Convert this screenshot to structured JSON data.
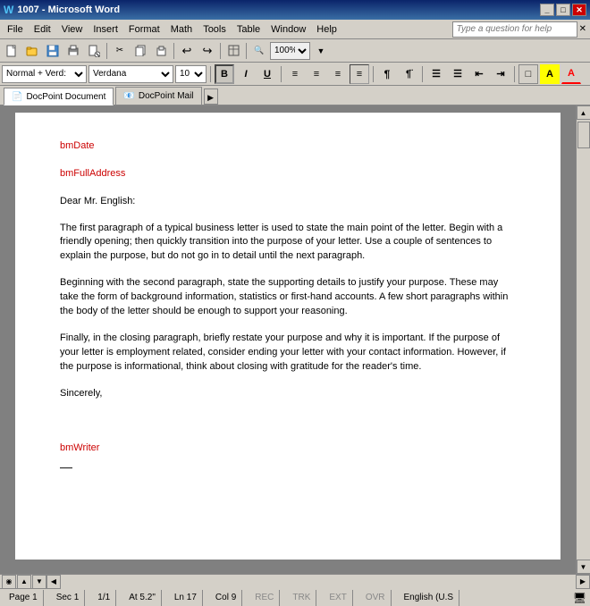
{
  "title_bar": {
    "title": "1007 - Microsoft Word",
    "icon": "W",
    "controls": [
      "_",
      "□",
      "✕"
    ]
  },
  "menu_bar": {
    "items": [
      "File",
      "Edit",
      "View",
      "Insert",
      "Format",
      "Math",
      "Tools",
      "Table",
      "Window",
      "Help"
    ],
    "search_placeholder": "Type a question for help"
  },
  "toolbar": {
    "buttons": [
      "📄",
      "📁",
      "💾",
      "🖨",
      "👁",
      "✂",
      "📋",
      "📎",
      "↩",
      "↪",
      "📊",
      "🔍"
    ],
    "zoom": "100%"
  },
  "format_toolbar": {
    "style": "Normal + Verd:",
    "font": "Verdana",
    "size": "10",
    "bold": true,
    "italic": false,
    "underline": false
  },
  "tabs": [
    {
      "label": "DocPoint Document",
      "active": true,
      "icon": "doc"
    },
    {
      "label": "DocPoint Mail",
      "active": false,
      "icon": "mail"
    }
  ],
  "document": {
    "bookmark1": "bmDate",
    "bookmark2": "bmFullAddress",
    "salutation": "Dear Mr. English:",
    "paragraph1": "The first paragraph of a typical business letter is used to state the main point of the letter. Begin with a friendly opening; then quickly transition into the purpose of your letter. Use a couple of sentences to explain the purpose, but do not go in to detail until the next paragraph.",
    "paragraph2": "Beginning with the second paragraph, state the supporting details to justify your purpose. These may take the form of background information, statistics or first-hand accounts. A few short paragraphs within the body of the letter should be enough to support your reasoning.",
    "paragraph3": "Finally, in the closing paragraph, briefly restate your purpose and why it is important. If the purpose of your letter is employment related, consider ending your letter with your contact information. However, if the purpose is informational, think about closing with gratitude for the reader's time.",
    "closing": "Sincerely,",
    "bookmark3": "bmWriter",
    "dash": "—"
  },
  "status_bar": {
    "page": "Page 1",
    "sec": "Sec 1",
    "pages": "1/1",
    "at": "At 5.2\"",
    "ln": "Ln 17",
    "col": "Col 9",
    "rec": "REC",
    "trk": "TRK",
    "ext": "EXT",
    "ovr": "OVR",
    "lang": "English (U.S"
  }
}
